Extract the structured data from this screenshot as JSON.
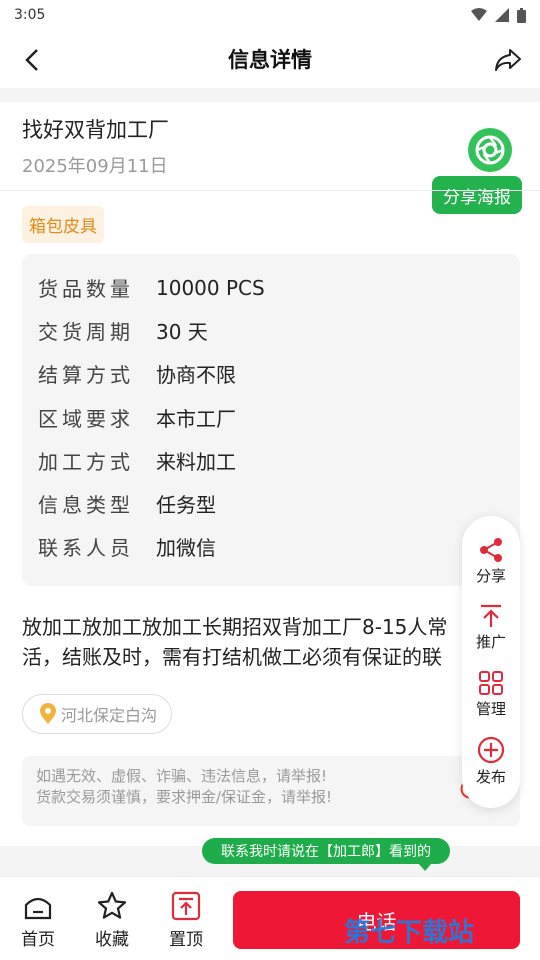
{
  "status_bar": {
    "time": "3:05"
  },
  "nav": {
    "title": "信息详情"
  },
  "post": {
    "title": "找好双背加工厂",
    "date": "2025年09月11日",
    "share_poster_label": "分享海报",
    "category": "箱包皮具"
  },
  "specs": [
    {
      "key": "货品数量",
      "value": "10000 PCS"
    },
    {
      "key": "交货周期",
      "value": "30 天"
    },
    {
      "key": "结算方式",
      "value": "协商不限"
    },
    {
      "key": "区域要求",
      "value": "本市工厂"
    },
    {
      "key": "加工方式",
      "value": "来料加工"
    },
    {
      "key": "信息类型",
      "value": "任务型"
    },
    {
      "key": "联系人员",
      "value": "加微信"
    }
  ],
  "description": {
    "line1": "放加工放加工放加工长期招双背加工厂8-15人常",
    "line2": "活，结账及时，需有打结机做工必须有保证的联"
  },
  "location": "河北保定白沟",
  "warning": {
    "line1": "如遇无效、虚假、诈骗、违法信息，请举报!",
    "line2": "货款交易须谨慎，要求押金/保证金，请举报!",
    "report_label": "举"
  },
  "float_menu": [
    {
      "label": "分享",
      "icon": "share-icon"
    },
    {
      "label": "推广",
      "icon": "promote-icon"
    },
    {
      "label": "管理",
      "icon": "manage-icon"
    },
    {
      "label": "发布",
      "icon": "publish-icon"
    }
  ],
  "contact_tip": "联系我时请说在【加工郎】看到的",
  "tabbar": {
    "home": "首页",
    "favorite": "收藏",
    "pin": "置顶",
    "call": "电话"
  },
  "watermark": "第七下载站",
  "colors": {
    "accent_green": "#23b24e",
    "call_red": "#ee1836",
    "tag_orange": "#e38b1a"
  }
}
